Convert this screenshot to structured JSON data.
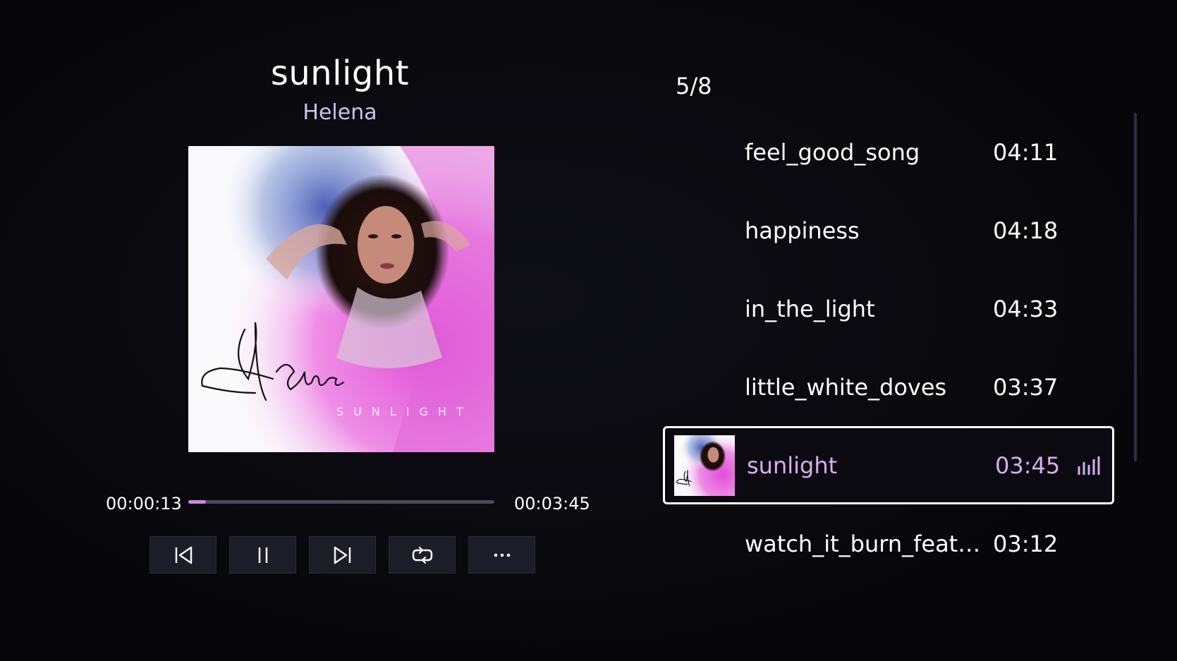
{
  "now_playing": {
    "title": "sunlight",
    "artist": "Helena",
    "elapsed": "00:00:13",
    "total": "00:03:45",
    "progress_percent": 5.8,
    "album_art": {
      "signature_text": "Helena",
      "cover_text": "SUNLIGHT"
    }
  },
  "controls": {
    "previous_icon": "skip-previous-icon",
    "pause_icon": "pause-icon",
    "next_icon": "skip-next-icon",
    "repeat_icon": "repeat-icon",
    "more_icon": "more-options-icon"
  },
  "playlist": {
    "counter": "5/8",
    "tracks": [
      {
        "name": "feel_good_song",
        "duration": "04:11"
      },
      {
        "name": "happiness",
        "duration": "04:18"
      },
      {
        "name": "in_the_light",
        "duration": "04:33"
      },
      {
        "name": "little_white_doves",
        "duration": "03:37"
      },
      {
        "name": "sunlight",
        "duration": "03:45",
        "active": true
      },
      {
        "name": "watch_it_burn_feat_...",
        "duration": "03:12"
      }
    ],
    "active_indicator_icon": "equalizer-icon"
  },
  "colors": {
    "background": "#07070b",
    "accent": "#c98be6",
    "active_text": "#d7aef0",
    "button_bg": "#1d1d27"
  }
}
